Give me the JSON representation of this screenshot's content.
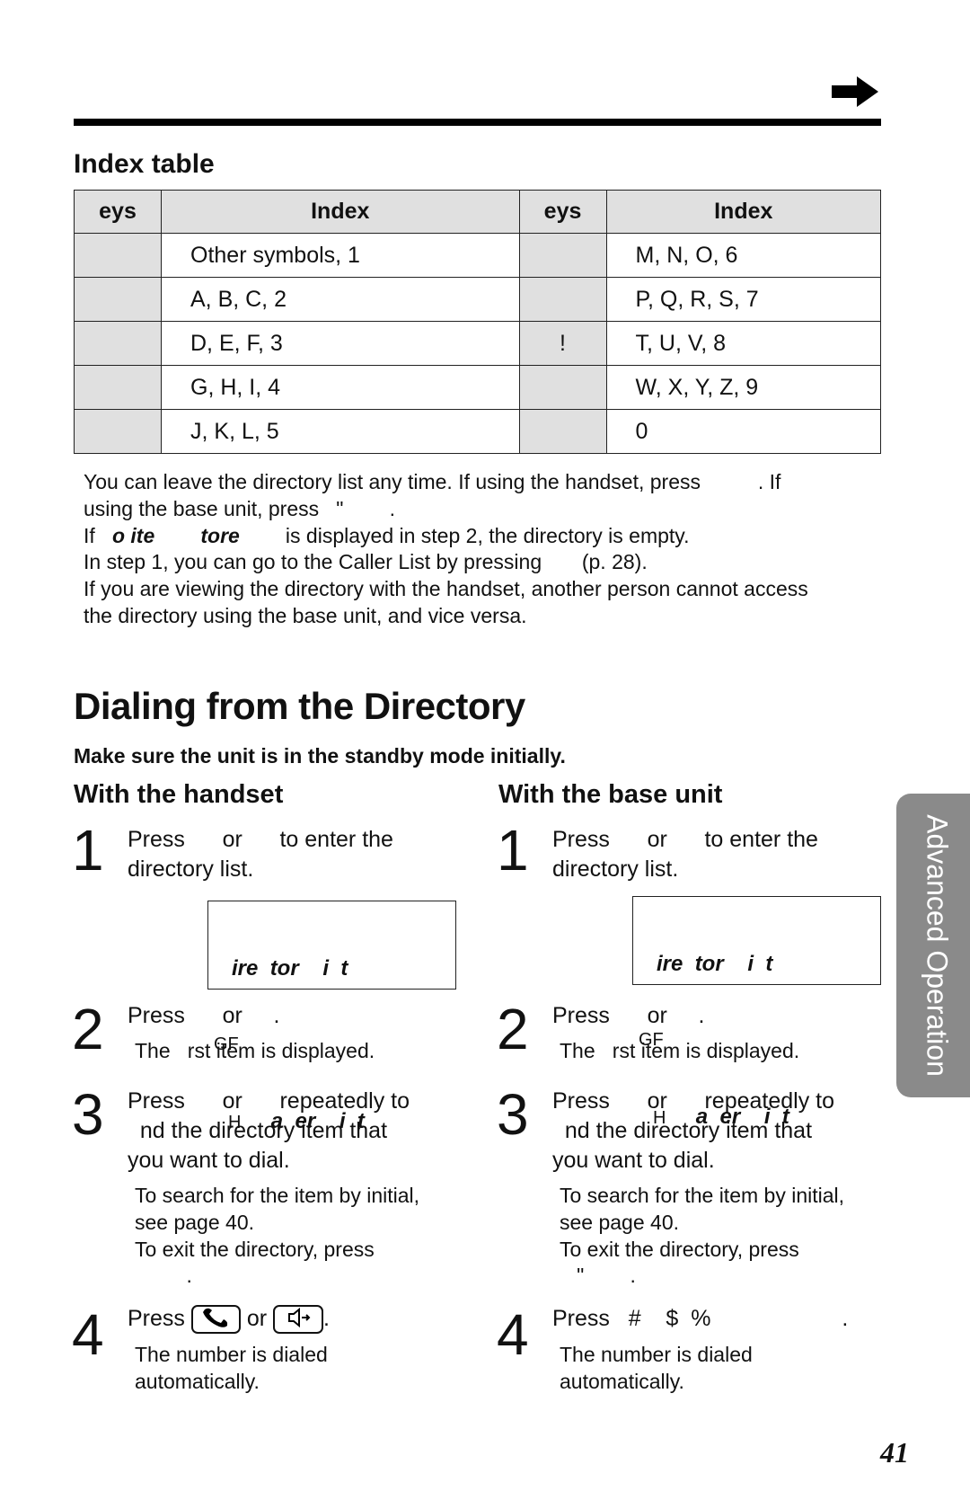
{
  "header": {
    "arrow_icon": "right-arrow"
  },
  "index_table": {
    "title": "Index table",
    "headers": [
      "eys",
      "Index",
      "eys",
      "Index"
    ],
    "rows": [
      [
        "",
        "Other symbols, 1",
        "",
        "M, N, O, 6"
      ],
      [
        "",
        "A, B, C, 2",
        "",
        "P, Q, R, S, 7"
      ],
      [
        "",
        "D, E, F, 3",
        "!",
        "T, U, V, 8"
      ],
      [
        "",
        "G, H, I, 4",
        "",
        "W, X, Y, Z, 9"
      ],
      [
        "",
        "J, K, L, 5",
        "",
        "0"
      ]
    ]
  },
  "notes": [
    "You can leave the directory list any time. If using the handset, press          . If",
    "using the base unit, press   \"        .",
    {
      "a": "If   ",
      "b": "o ite        tore",
      "c": "        is displayed in step 2, the directory is empty."
    },
    "In step 1, you can go to the Caller List by pressing       (p. 28).",
    "If you are viewing the directory with the handset, another person cannot access",
    "the directory using the base unit, and vice versa."
  ],
  "section": {
    "title": "Dialing from the Directory",
    "subtitle": "Make sure the unit is in the standby mode initially.",
    "side_tab": "Advanced Operation",
    "page_number": "41"
  },
  "handset": {
    "heading": "With the handset",
    "step1": {
      "num": "1",
      "lines": [
        "Press      or      to enter the",
        "directory list."
      ]
    },
    "display": {
      "line1": "ire  tor    i  t",
      "line2": "GF",
      "line3a": "H",
      "line3b": "a  er    i  t"
    },
    "step2": {
      "num": "2",
      "text": "Press      or     .",
      "sub": "The   rst item is displayed."
    },
    "step3": {
      "num": "3",
      "lines": [
        "Press      or      repeatedly to",
        "  nd the directory item that",
        "you want to dial."
      ],
      "sub": [
        "To search for the item by initial,",
        "see page 40.",
        "To exit the directory, press",
        "         ."
      ]
    },
    "step4": {
      "num": "4",
      "press": "Press",
      "or": "or",
      "end": ".",
      "talk_icon": "phone-handset",
      "speaker_icon": "speakerphone",
      "sub": [
        "The number is dialed",
        "automatically."
      ]
    }
  },
  "base": {
    "heading": "With the base unit",
    "step1": {
      "num": "1",
      "lines": [
        "Press      or      to enter the",
        "directory list."
      ]
    },
    "display": {
      "line1": "ire  tor    i  t",
      "line2": "GF",
      "line3a": "H",
      "line3b": "a  er    i  t"
    },
    "step2": {
      "num": "2",
      "text": "Press      or     .",
      "sub": "The   rst item is displayed."
    },
    "step3": {
      "num": "3",
      "lines": [
        "Press      or      repeatedly to",
        "  nd the directory item that",
        "you want to dial."
      ],
      "sub": [
        "To search for the item by initial,",
        "see page 40.",
        "To exit the directory, press",
        "   \"        ."
      ]
    },
    "step4": {
      "num": "4",
      "text": "Press   #    $  %                     .",
      "sub": [
        "The number is dialed",
        "automatically."
      ]
    }
  }
}
